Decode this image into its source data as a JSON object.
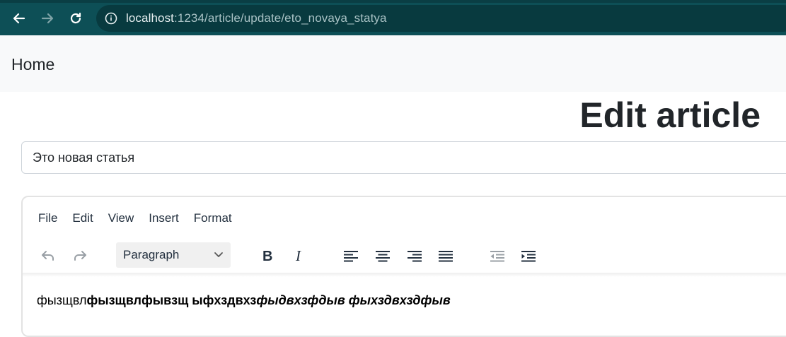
{
  "browser": {
    "url_host": "localhost",
    "url_path": ":1234/article/update/eto_novaya_statya"
  },
  "navbar": {
    "home_label": "Home"
  },
  "page": {
    "heading": "Edit article"
  },
  "form": {
    "title_value": "Это новая статья"
  },
  "editor": {
    "menu": [
      "File",
      "Edit",
      "View",
      "Insert",
      "Format"
    ],
    "block_format": "Paragraph",
    "content": {
      "plain": "фызщвл",
      "bold": "фызщвлфывзщ ыфхздвхз",
      "bold_italic": "фыдвхзфдыв фыхздвхздфыв"
    }
  },
  "icons": [
    "back-arrow-icon",
    "forward-arrow-icon",
    "reload-icon",
    "info-icon",
    "undo-icon",
    "redo-icon",
    "chevron-down-icon",
    "bold-icon",
    "italic-icon",
    "align-left-icon",
    "align-center-icon",
    "align-right-icon",
    "align-justify-icon",
    "outdent-icon",
    "indent-icon"
  ],
  "colors": {
    "browser_bar": "#0d4f56",
    "omnibox": "#083a3f",
    "navbar": "#f8f9fa",
    "text": "#212529"
  }
}
